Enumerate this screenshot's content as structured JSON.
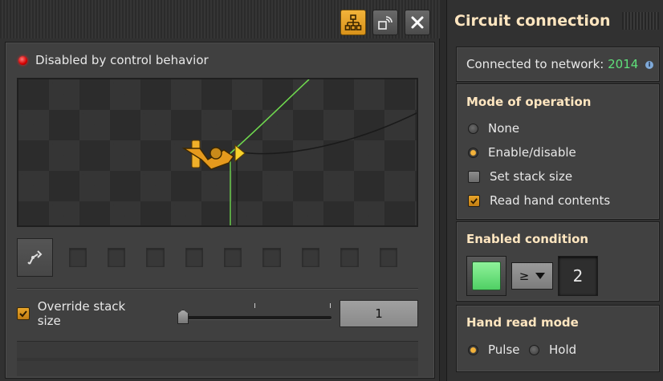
{
  "left_panel": {
    "titlebar": {
      "buttons": [
        {
          "icon": "circuit-network-icon",
          "active": true
        },
        {
          "icon": "logistic-network-icon",
          "active": false
        },
        {
          "icon": "close-icon",
          "active": false
        }
      ]
    },
    "status": {
      "led_color": "#e00000",
      "text": "Disabled by control behavior"
    },
    "filter_slots": 9,
    "override": {
      "label": "Override stack size",
      "checked": true,
      "slider_fraction": 0.0,
      "value": "1"
    }
  },
  "right_panel": {
    "title": "Circuit connection",
    "network": {
      "label": "Connected to network:",
      "id": "2014",
      "id_color": "#5fe07a"
    },
    "mode": {
      "title": "Mode of operation",
      "options": [
        {
          "label": "None",
          "kind": "radio",
          "selected": false
        },
        {
          "label": "Enable/disable",
          "kind": "radio",
          "selected": true
        },
        {
          "label": "Set stack size",
          "kind": "checkbox",
          "selected": false
        },
        {
          "label": "Read hand contents",
          "kind": "checkbox",
          "selected": true
        }
      ]
    },
    "condition": {
      "title": "Enabled condition",
      "signal_color": "#6fe07f",
      "comparator": "≥",
      "constant": "2"
    },
    "hand_read": {
      "title": "Hand read mode",
      "options": [
        {
          "label": "Pulse",
          "selected": true
        },
        {
          "label": "Hold",
          "selected": false
        }
      ]
    }
  },
  "colors": {
    "accent": "#e8a52a",
    "title": "#ffe6c0"
  }
}
